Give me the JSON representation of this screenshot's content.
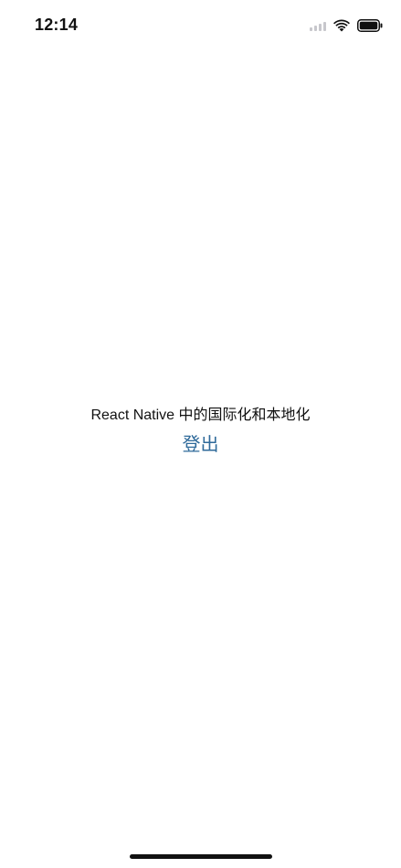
{
  "status_bar": {
    "time": "12:14",
    "icons": [
      "cellular-signal-icon",
      "wifi-icon",
      "battery-icon"
    ]
  },
  "main": {
    "heading": "React Native 中的国际化和本地化",
    "logout_label": "登出"
  },
  "colors": {
    "background": "#ffffff",
    "text": "#111111",
    "link": "#2f6a9a"
  }
}
